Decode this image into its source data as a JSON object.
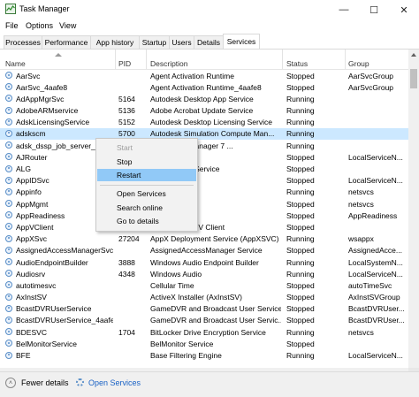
{
  "window": {
    "title": "Task Manager",
    "controls": [
      "—",
      "☐",
      "✕"
    ]
  },
  "menu": [
    "File",
    "Options",
    "View"
  ],
  "tabs": [
    "Processes",
    "Performance",
    "App history",
    "Startup",
    "Users",
    "Details",
    "Services"
  ],
  "active_tab": "Services",
  "columns": [
    "Name",
    "PID",
    "Description",
    "Status",
    "Group"
  ],
  "rows": [
    {
      "name": "AarSvc",
      "pid": "",
      "description": "Agent Activation Runtime",
      "status": "Stopped",
      "group": "AarSvcGroup"
    },
    {
      "name": "AarSvc_4aafe8",
      "pid": "",
      "description": "Agent Activation Runtime_4aafe8",
      "status": "Stopped",
      "group": "AarSvcGroup"
    },
    {
      "name": "AdAppMgrSvc",
      "pid": "5164",
      "description": "Autodesk Desktop App Service",
      "status": "Running",
      "group": ""
    },
    {
      "name": "AdobeARMservice",
      "pid": "5136",
      "description": "Adobe Acrobat Update Service",
      "status": "Running",
      "group": ""
    },
    {
      "name": "AdskLicensingService",
      "pid": "5152",
      "description": "Autodesk Desktop Licensing Service",
      "status": "Running",
      "group": ""
    },
    {
      "name": "adskscm",
      "pid": "5700",
      "description": "Autodesk Simulation Compute Man...",
      "status": "Running",
      "group": ""
    },
    {
      "name": "adsk_dssp_job_server_7",
      "pid": "",
      "description": "ulation Job Manager 7 ...",
      "status": "Running",
      "group": ""
    },
    {
      "name": "AJRouter",
      "pid": "",
      "description": "",
      "status": "Stopped",
      "group": "LocalServiceN..."
    },
    {
      "name": "ALG",
      "pid": "",
      "description": "yer Gateway Service",
      "status": "Stopped",
      "group": ""
    },
    {
      "name": "AppIDSvc",
      "pid": "",
      "description": "entity",
      "status": "Stopped",
      "group": "LocalServiceN..."
    },
    {
      "name": "Appinfo",
      "pid": "",
      "description": "",
      "status": "Running",
      "group": "netsvcs"
    },
    {
      "name": "AppMgmt",
      "pid": "",
      "description": "agement",
      "status": "Stopped",
      "group": "netsvcs"
    },
    {
      "name": "AppReadiness",
      "pid": "",
      "description": "",
      "status": "Stopped",
      "group": "AppReadiness"
    },
    {
      "name": "AppVClient",
      "pid": "",
      "description": "Microsoft App-V Client",
      "status": "Stopped",
      "group": ""
    },
    {
      "name": "AppXSvc",
      "pid": "27204",
      "description": "AppX Deployment Service (AppXSVC)",
      "status": "Running",
      "group": "wsappx"
    },
    {
      "name": "AssignedAccessManagerSvc",
      "pid": "",
      "description": "AssignedAccessManager Service",
      "status": "Stopped",
      "group": "AssignedAcce..."
    },
    {
      "name": "AudioEndpointBuilder",
      "pid": "3888",
      "description": "Windows Audio Endpoint Builder",
      "status": "Running",
      "group": "LocalSystemN..."
    },
    {
      "name": "Audiosrv",
      "pid": "4348",
      "description": "Windows Audio",
      "status": "Running",
      "group": "LocalServiceN..."
    },
    {
      "name": "autotimesvc",
      "pid": "",
      "description": "Cellular Time",
      "status": "Stopped",
      "group": "autoTimeSvc"
    },
    {
      "name": "AxInstSV",
      "pid": "",
      "description": "ActiveX Installer (AxInstSV)",
      "status": "Stopped",
      "group": "AxInstSVGroup"
    },
    {
      "name": "BcastDVRUserService",
      "pid": "",
      "description": "GameDVR and Broadcast User Service",
      "status": "Stopped",
      "group": "BcastDVRUser..."
    },
    {
      "name": "BcastDVRUserService_4aafe8",
      "pid": "",
      "description": "GameDVR and Broadcast User Servic...",
      "status": "Stopped",
      "group": "BcastDVRUser..."
    },
    {
      "name": "BDESVC",
      "pid": "1704",
      "description": "BitLocker Drive Encryption Service",
      "status": "Running",
      "group": "netsvcs"
    },
    {
      "name": "BelMonitorService",
      "pid": "",
      "description": "BelMonitor Service",
      "status": "Stopped",
      "group": ""
    },
    {
      "name": "BFE",
      "pid": "",
      "description": "Base Filtering Engine",
      "status": "Running",
      "group": "LocalServiceN..."
    }
  ],
  "selected_row": "adskscm",
  "context_menu": {
    "items": [
      "Start",
      "Stop",
      "Restart",
      "Open Services",
      "Search online",
      "Go to details"
    ],
    "disabled": "Start",
    "highlighted": "Restart"
  },
  "footer": {
    "fewer_details": "Fewer details",
    "open_services": "Open Services"
  },
  "colors": {
    "selection": "#cce8ff",
    "menu_hover": "#91c9f7",
    "link": "#1a62c5",
    "service_icon": "#5a8fc8"
  }
}
